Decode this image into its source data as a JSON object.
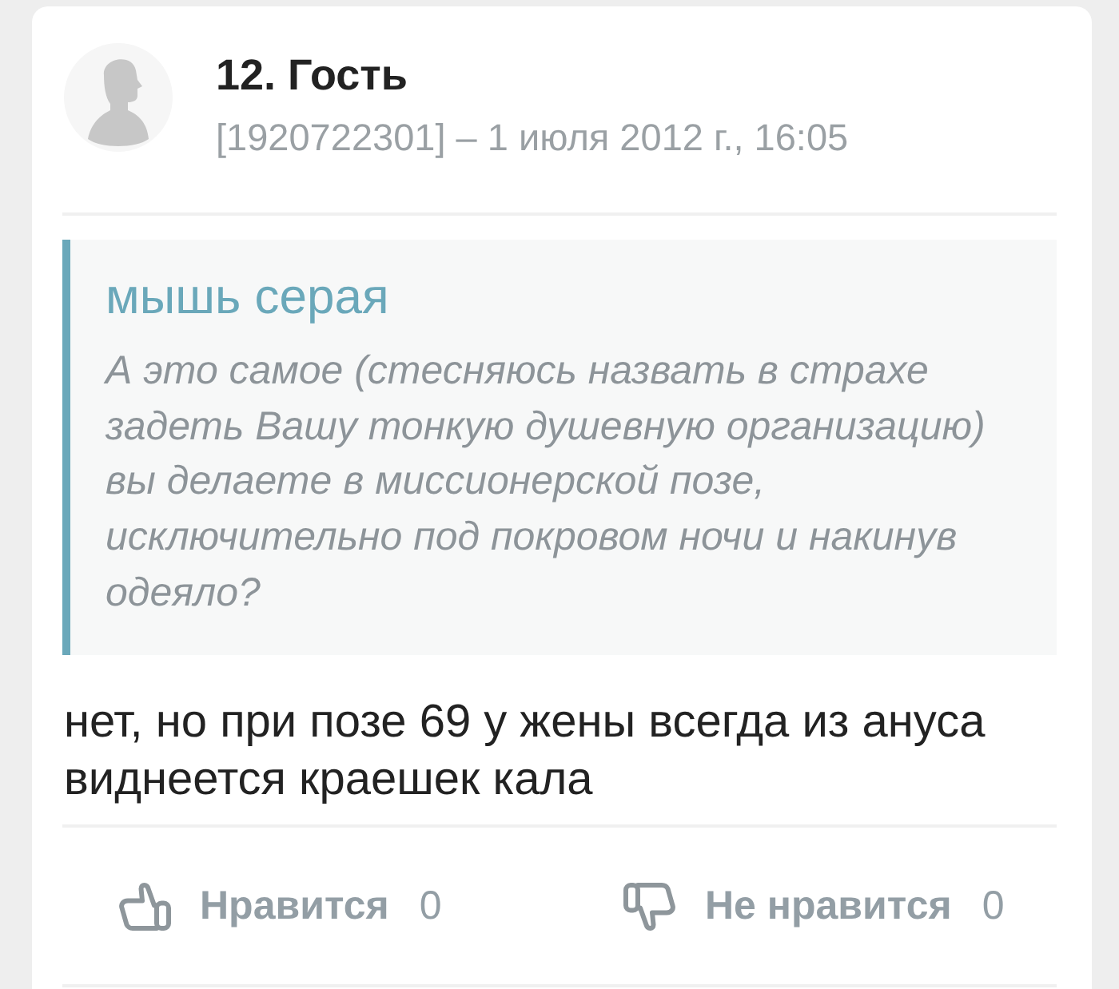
{
  "comment": {
    "author": "12. Гость",
    "meta": "[1920722301] – 1 июля 2012 г., 16:05"
  },
  "quote": {
    "author": "мышь серая",
    "text": "А это самое (стесняюсь назвать в страхе задеть Вашу тонкую душевную организацию) вы делаете в миссионерской позе, исключительно под покровом ночи и накинув одеяло?"
  },
  "body": "нет, но при позе 69 у жены всегда из ануса виднеется краешек кала",
  "reactions": [
    {
      "kind": "like",
      "label": "Нравится",
      "count": "0"
    },
    {
      "kind": "dislike",
      "label": "Не нравится",
      "count": "0"
    }
  ]
}
